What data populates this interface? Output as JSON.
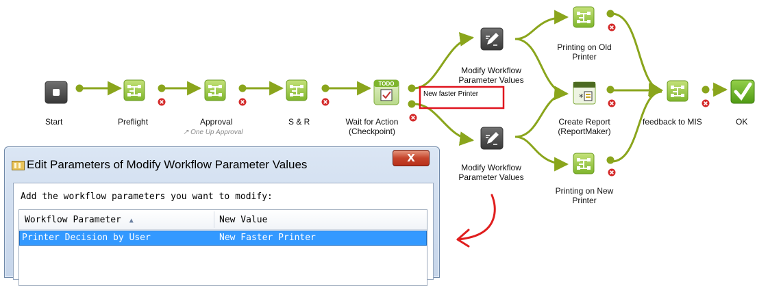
{
  "workflow": {
    "nodes": {
      "start": {
        "label": "Start"
      },
      "preflight": {
        "label": "Preflight"
      },
      "approval": {
        "label": "Approval",
        "sublabel": "↗ One Up Approval"
      },
      "s_and_r": {
        "label": "S & R"
      },
      "wait_for_action": {
        "label": "Wait for Action\n(Checkpoint)",
        "badge": "TODO"
      },
      "modify_top": {
        "label": "Modify Workflow\nParameter Values"
      },
      "modify_bottom": {
        "label": "Modify Workflow\nParameter Values"
      },
      "printing_old": {
        "label": "Printing on Old\nPrinter"
      },
      "create_report": {
        "label": "Create Report\n(ReportMaker)"
      },
      "printing_new": {
        "label": "Printing on New\nPrinter"
      },
      "feedback_mis": {
        "label": "feedback to MIS"
      },
      "ok": {
        "label": "OK"
      }
    },
    "decision_note": "New faster Printer"
  },
  "dialog": {
    "title": "Edit Parameters of Modify Workflow Parameter Values",
    "close_label": "X",
    "instruction": "Add the workflow parameters you want to modify:",
    "columns": [
      "Workflow Parameter",
      "New Value"
    ],
    "sort_indicator": "▲",
    "rows": [
      {
        "parameter": "Printer Decision by User",
        "value": "New Faster Printer"
      }
    ]
  },
  "colors": {
    "connector": "#8aa51c",
    "node_green": "#8cc43c",
    "start_dark": "#555555",
    "ok_green": "#6ab023",
    "error_red": "#d42a2a",
    "highlight_box": "#e0141e",
    "annotation_arrow": "#e01e1e",
    "row_selected": "#3399ff"
  }
}
